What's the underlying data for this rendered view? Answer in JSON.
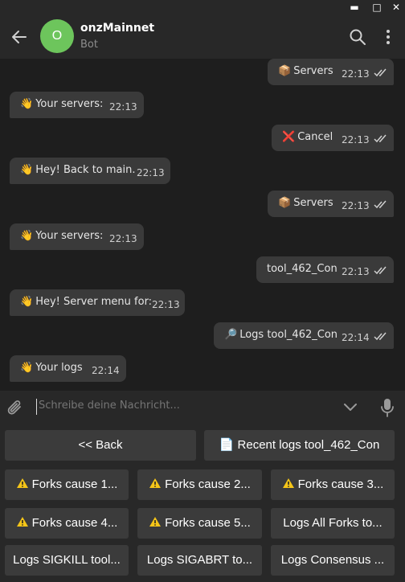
{
  "window": {
    "minimize": "▬",
    "maximize": "□",
    "close": "✕"
  },
  "header": {
    "avatar_letter": "O",
    "title": "onzMainnet",
    "subtitle": "Bot"
  },
  "messages": [
    {
      "dir": "out",
      "emoji": "📦",
      "text": "Servers",
      "time": "22:13",
      "read": true
    },
    {
      "dir": "in",
      "emoji": "👋",
      "text": "Your servers:",
      "time": "22:13"
    },
    {
      "dir": "out",
      "emoji": "❌",
      "text": "Cancel",
      "time": "22:13",
      "read": true
    },
    {
      "dir": "in",
      "emoji": "👋",
      "text": "Hey! Back to main.",
      "time": "22:13"
    },
    {
      "dir": "out",
      "emoji": "📦",
      "text": "Servers",
      "time": "22:13",
      "read": true
    },
    {
      "dir": "in",
      "emoji": "👋",
      "text": "Your servers:",
      "time": "22:13"
    },
    {
      "dir": "out",
      "emoji": "",
      "text": "tool_462_Con",
      "time": "22:13",
      "read": true
    },
    {
      "dir": "in",
      "emoji": "👋",
      "text": "Hey! Server menu for:",
      "time": "22:13"
    },
    {
      "dir": "out",
      "emoji": "🔎",
      "text": "Logs tool_462_Con",
      "time": "22:14",
      "read": true
    },
    {
      "dir": "in",
      "emoji": "👋",
      "text": "Your logs",
      "time": "22:14"
    }
  ],
  "composer": {
    "placeholder": "Schreibe deine Nachricht..."
  },
  "keyboard": {
    "rows": [
      [
        "<< Back",
        "📄 Recent logs tool_462_Con"
      ],
      [
        "Forks cause 1...",
        "Forks cause 2...",
        "Forks cause 3..."
      ],
      [
        "Forks cause 4...",
        "Forks cause 5...",
        "Logs All Forks to..."
      ],
      [
        "Logs SIGKILL tool...",
        "Logs SIGABRT to...",
        "Logs Consensus ..."
      ]
    ]
  },
  "colors": {
    "accent": "#6dc55c",
    "bubble": "#3a3a3a",
    "background": "#1e1e1e",
    "panel": "#282828",
    "key": "#3b3b3b",
    "warning": "#f5c518"
  }
}
